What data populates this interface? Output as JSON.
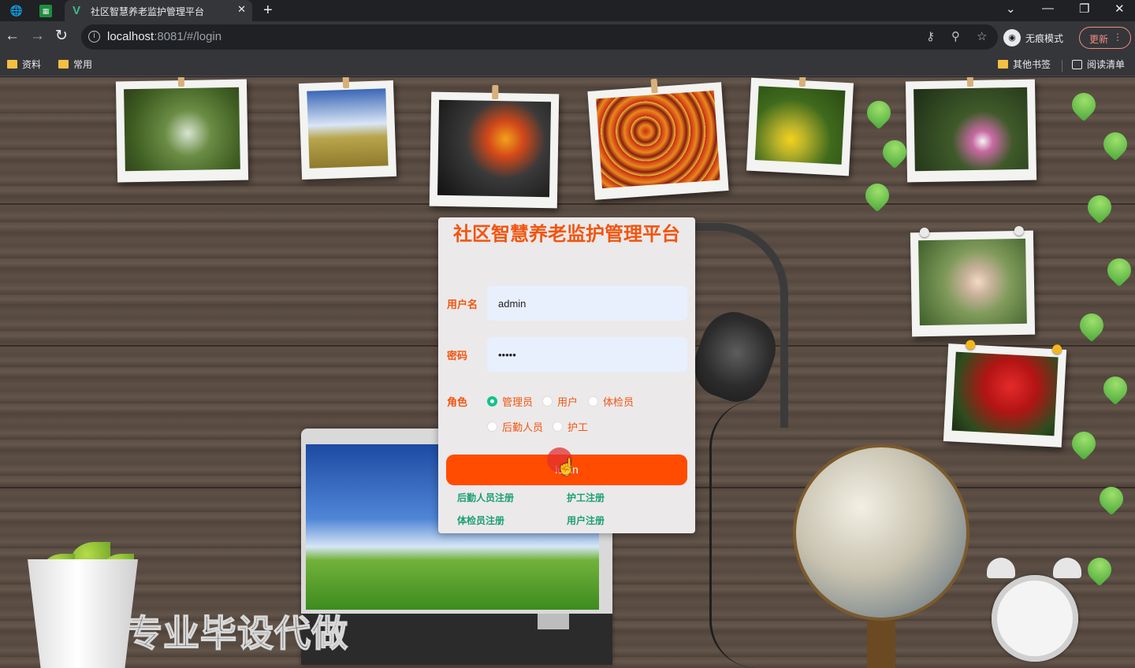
{
  "browser": {
    "tab_title": "社区智慧养老监护管理平台",
    "address": {
      "host": "localhost",
      "rest": ":8081/#/login"
    },
    "profile_label": "无痕模式",
    "update_label": "更新",
    "bookmarks": [
      {
        "label": "资料"
      },
      {
        "label": "常用"
      }
    ],
    "bookmarks_right": [
      {
        "label": "其他书签"
      },
      {
        "label": "阅读清单"
      }
    ]
  },
  "login": {
    "title": "社区智慧养老监护管理平台",
    "username_label": "用户名",
    "username_value": "admin",
    "password_label": "密码",
    "password_value": "•••••",
    "role_label": "角色",
    "roles": [
      {
        "label": "管理员",
        "selected": true
      },
      {
        "label": "用户",
        "selected": false
      },
      {
        "label": "体检员",
        "selected": false
      },
      {
        "label": "后勤人员",
        "selected": false
      },
      {
        "label": "护工",
        "selected": false
      }
    ],
    "button_label": "login",
    "register_links": [
      {
        "label": "后勤人员注册"
      },
      {
        "label": "护工注册"
      },
      {
        "label": "体检员注册"
      },
      {
        "label": "用户注册"
      }
    ]
  },
  "watermark": "专业毕设代做",
  "colors": {
    "accent": "#f2550f",
    "button": "#ff4c00",
    "link": "#1aa172",
    "radio_selected": "#13c28c"
  }
}
